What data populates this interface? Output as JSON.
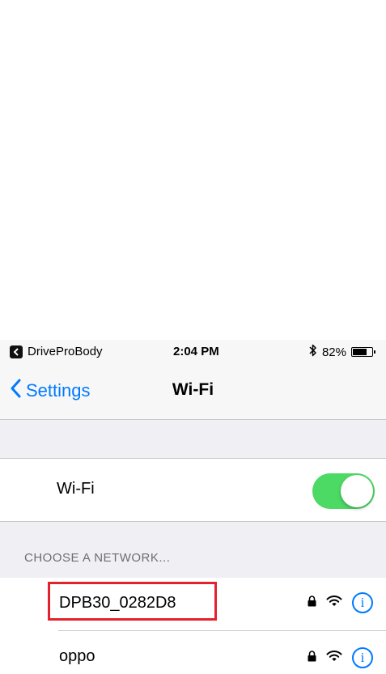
{
  "status_bar": {
    "back_app": "DriveProBody",
    "time": "2:04 PM",
    "battery_percent": "82%",
    "battery_level": 0.82,
    "icons": [
      "back-to-app-icon",
      "bluetooth-icon",
      "battery-icon"
    ]
  },
  "nav": {
    "back_label": "Settings",
    "title": "Wi-Fi"
  },
  "wifi_toggle": {
    "label": "Wi-Fi",
    "enabled": true
  },
  "networks": {
    "section_header": "CHOOSE A NETWORK...",
    "items": [
      {
        "name": "DPB30_0282D8",
        "secured": true,
        "highlighted": true
      },
      {
        "name": "oppo",
        "secured": true,
        "highlighted": false
      }
    ]
  },
  "colors": {
    "accent": "#007aff",
    "toggle_on": "#4cd964",
    "highlight": "#e3222d",
    "group_background": "#efeff4"
  }
}
